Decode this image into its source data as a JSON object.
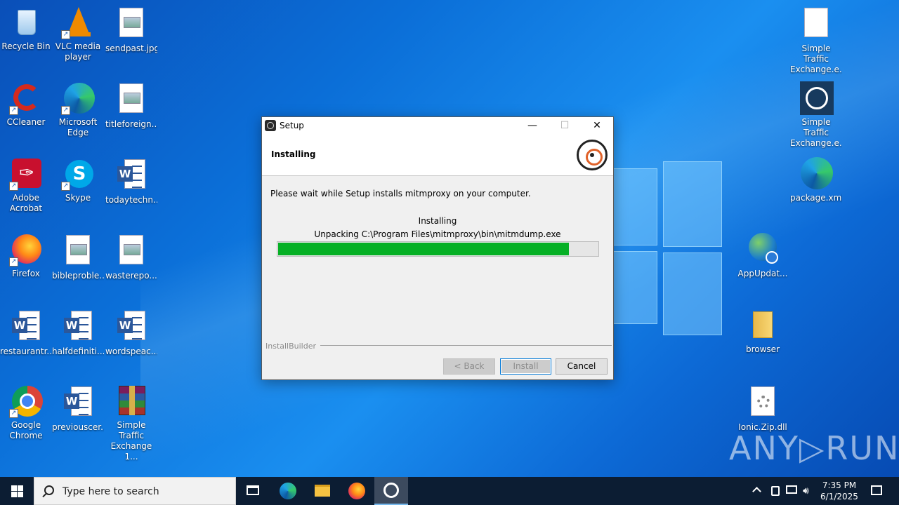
{
  "desktop": {
    "icons": [
      {
        "label": "Recycle Bin",
        "icon": "recycle-bin-icon"
      },
      {
        "label": "VLC media player",
        "icon": "vlc-icon"
      },
      {
        "label": "sendpast.jpg",
        "icon": "image-file-icon"
      },
      {
        "label": "CCleaner",
        "icon": "ccleaner-icon"
      },
      {
        "label": "Microsoft Edge",
        "icon": "edge-icon"
      },
      {
        "label": "titleforeign....",
        "icon": "image-file-icon"
      },
      {
        "label": "Adobe Acrobat",
        "icon": "acrobat-icon"
      },
      {
        "label": "Skype",
        "icon": "skype-icon"
      },
      {
        "label": "todaytechn...",
        "icon": "word-doc-icon"
      },
      {
        "label": "Firefox",
        "icon": "firefox-icon"
      },
      {
        "label": "bibleproble...",
        "icon": "image-file-icon"
      },
      {
        "label": "wasterepo...",
        "icon": "image-file-icon"
      },
      {
        "label": "restaurantr...",
        "icon": "word-doc-icon"
      },
      {
        "label": "halfdefiniti...",
        "icon": "word-doc-icon"
      },
      {
        "label": "wordspeac...",
        "icon": "word-doc-icon"
      },
      {
        "label": "Google Chrome",
        "icon": "chrome-icon"
      },
      {
        "label": "previouscer...",
        "icon": "word-doc-icon"
      },
      {
        "label": "Simple Traffic Exchange 1...",
        "icon": "winrar-icon"
      },
      {
        "label": "Simple Traffic Exchange.e...",
        "icon": "blank-file-icon"
      },
      {
        "label": "Simple Traffic Exchange.e...",
        "icon": "globe-app-icon"
      },
      {
        "label": "package.xml",
        "icon": "edge-icon"
      },
      {
        "label": "AppUpdat...",
        "icon": "globe-update-icon"
      },
      {
        "label": "browser",
        "icon": "folder-icon"
      },
      {
        "label": "Ionic.Zip.dll",
        "icon": "dll-file-icon"
      }
    ]
  },
  "setup": {
    "title": "Setup",
    "header_title": "Installing",
    "message": "Please wait while Setup installs mitmproxy on your computer.",
    "status": "Installing",
    "detail": "Unpacking C:\\Program Files\\mitmproxy\\bin\\mitmdump.exe",
    "progress": 0.91,
    "brand": "InstallBuilder",
    "buttons": {
      "back": "< Back",
      "install": "Install",
      "cancel": "Cancel"
    },
    "controls": {
      "minimize": "—",
      "maximize": "☐",
      "close": "✕"
    }
  },
  "taskbar": {
    "search_placeholder": "Type here to search",
    "time": "7:35 PM",
    "date": "6/1/2025"
  },
  "watermark": "ANY RUN"
}
